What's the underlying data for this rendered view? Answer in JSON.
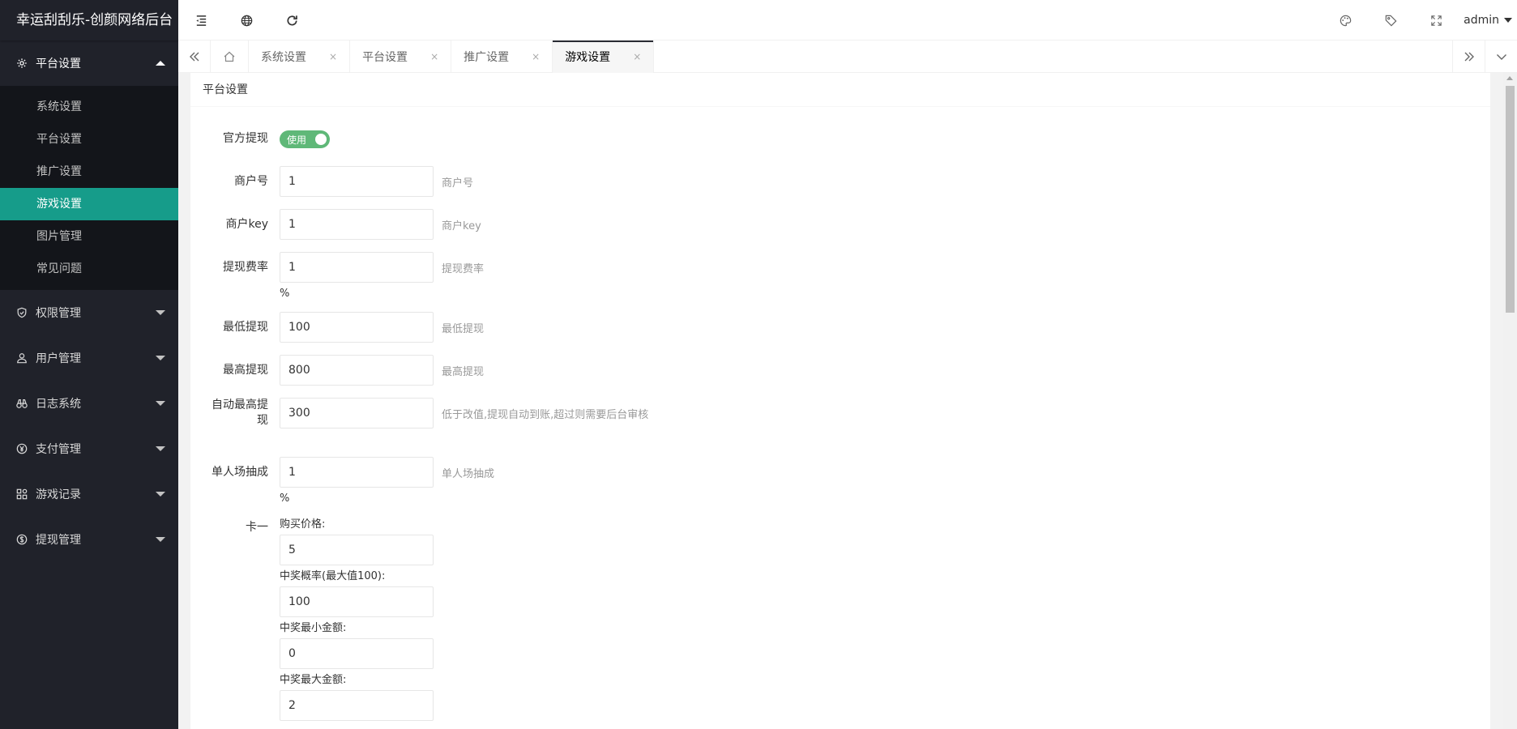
{
  "app": {
    "title": "幸运刮刮乐-创颜网络后台"
  },
  "sidebar": {
    "groups": [
      {
        "label": "平台设置",
        "icon": "gear-icon",
        "open": true,
        "items": [
          {
            "label": "系统设置"
          },
          {
            "label": "平台设置"
          },
          {
            "label": "推广设置"
          },
          {
            "label": "游戏设置",
            "active": true
          },
          {
            "label": "图片管理"
          },
          {
            "label": "常见问题"
          }
        ]
      },
      {
        "label": "权限管理",
        "icon": "shield-icon"
      },
      {
        "label": "用户管理",
        "icon": "user-icon"
      },
      {
        "label": "日志系统",
        "icon": "binoculars-icon"
      },
      {
        "label": "支付管理",
        "icon": "yen-icon"
      },
      {
        "label": "游戏记录",
        "icon": "apps-icon"
      },
      {
        "label": "提现管理",
        "icon": "dollar-icon"
      }
    ]
  },
  "header": {
    "user": "admin"
  },
  "tabs": [
    {
      "label": "系统设置"
    },
    {
      "label": "平台设置"
    },
    {
      "label": "推广设置"
    },
    {
      "label": "游戏设置",
      "active": true
    }
  ],
  "tab_close": "×",
  "card": {
    "title": "平台设置"
  },
  "form": {
    "withdraw": {
      "label": "官方提现",
      "switch_text": "使用",
      "on": true
    },
    "merchant_no": {
      "label": "商户号",
      "value": "1",
      "hint": "商户号"
    },
    "merchant_key": {
      "label": "商户key",
      "value": "1",
      "hint": "商户key"
    },
    "fee_rate": {
      "label": "提现费率",
      "value": "1",
      "hint": "提现费率",
      "unit": "%"
    },
    "min_withdraw": {
      "label": "最低提现",
      "value": "100",
      "hint": "最低提现"
    },
    "max_withdraw": {
      "label": "最高提现",
      "value": "800",
      "hint": "最高提现"
    },
    "auto_max": {
      "label_line1": "自动最高提",
      "label_line2": "现",
      "value": "300",
      "hint": "低于改值,提现自动到账,超过则需要后台审核"
    },
    "single_cut": {
      "label": "单人场抽成",
      "value": "1",
      "hint": "单人场抽成",
      "unit": "%"
    },
    "card1": {
      "label": "卡一",
      "price_label": "购买价格:",
      "price": "5",
      "prob_label": "中奖概率(最大值100):",
      "prob": "100",
      "min_label": "中奖最小金额:",
      "min": "0",
      "max_label": "中奖最大金额:",
      "max": "2"
    }
  }
}
